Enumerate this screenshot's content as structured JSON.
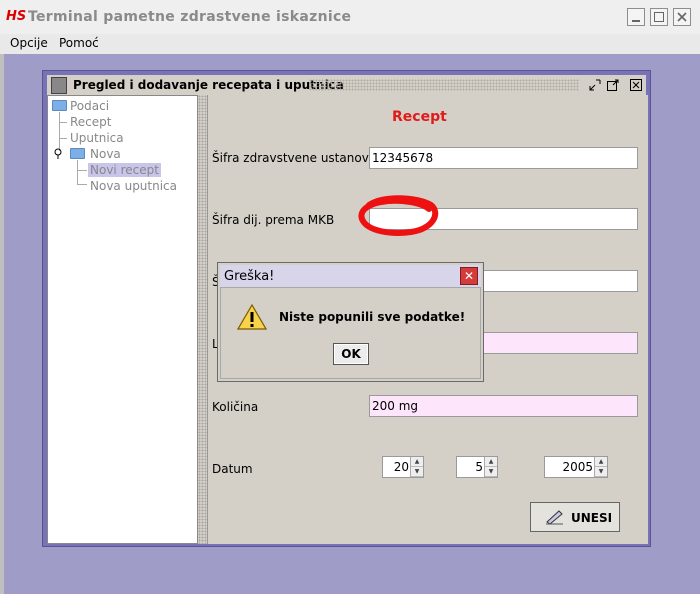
{
  "window": {
    "title": "Terminal pametne zdrastvene iskaznice",
    "logo": "HS"
  },
  "menu": {
    "items": [
      "Opcije",
      "Pomoć"
    ]
  },
  "internal": {
    "title": "Pregled i dodavanje recepata i uputnica"
  },
  "tree": {
    "root": "Podaci",
    "items": [
      "Recept",
      "Uputnica",
      "Nova"
    ],
    "children": [
      "Novi recept",
      "Nova uputnica"
    ]
  },
  "form": {
    "heading": "Recept",
    "fields": [
      {
        "label": "Šifra zdravstvene ustanove",
        "value": "12345678"
      },
      {
        "label": "Šifra dij. prema MKB",
        "value": ""
      },
      {
        "label": "Š",
        "value": ""
      },
      {
        "label": "L",
        "value": ""
      },
      {
        "label": "Količina",
        "value": "200 mg"
      }
    ],
    "date": {
      "label": "Datum",
      "day": "20",
      "month": "5",
      "year": "2005"
    },
    "submit": "UNESI"
  },
  "dialog": {
    "title": "Greška!",
    "message": "Niste popunili sve podatke!",
    "ok": "OK",
    "close": "✕"
  },
  "colors": {
    "heading": "#e21a1a",
    "desktop": "#9f9cc8",
    "pink_input": "#fde6fb",
    "annotation": "#ff0000"
  }
}
